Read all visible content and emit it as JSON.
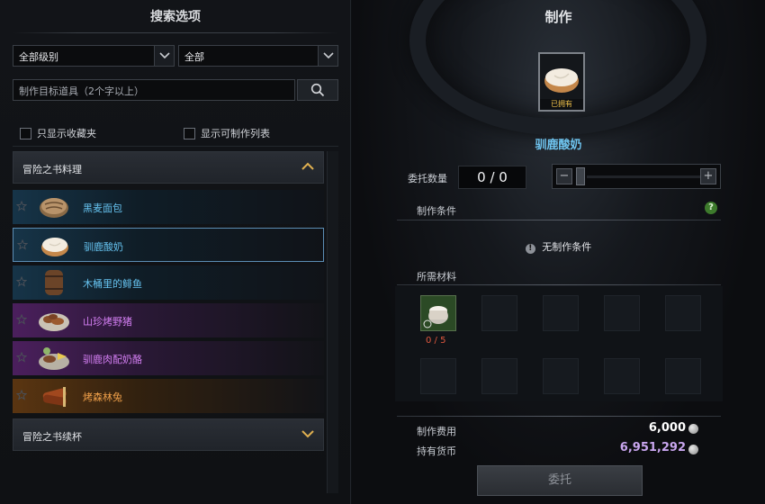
{
  "filters": {
    "title": "搜索选项",
    "grade_select": "全部级别",
    "type_select": "全部",
    "search_placeholder": "制作目标道具（2个字以上）",
    "favorites_only": "只显示收藏夹",
    "craftable_only": "显示可制作列表"
  },
  "categories": {
    "open_title": "冒险之书料理",
    "collapsed_title": "冒险之书续杯"
  },
  "recipes": [
    {
      "name": "黑麦面包",
      "rarity": "blue"
    },
    {
      "name": "驯鹿酸奶",
      "rarity": "blue",
      "selected": true
    },
    {
      "name": "木桶里的鲱鱼",
      "rarity": "blue"
    },
    {
      "name": "山珍烤野猪",
      "rarity": "purple"
    },
    {
      "name": "驯鹿肉配奶酪",
      "rarity": "purple"
    },
    {
      "name": "烤森林兔",
      "rarity": "orange"
    }
  ],
  "craft": {
    "title": "制作",
    "owned_tag": "已拥有",
    "product_name": "驯鹿酸奶",
    "qty_label": "委托数量",
    "qty_value": "0 / 0",
    "slider_minus": "−",
    "slider_plus": "+",
    "condition_label": "制作条件",
    "help": "?",
    "no_condition": "无制作条件",
    "materials_label": "所需材料",
    "material_count": "0 / 5",
    "cost_label": "制作费用",
    "cost_value": "6,000",
    "balance_label": "持有货币",
    "balance_value": "6,951,292",
    "commit_button": "委托"
  },
  "colors": {
    "rarity_blue": "#66c3f0",
    "rarity_purple": "#d47ff3",
    "rarity_orange": "#f0a04a",
    "missing_material": "#e0583f",
    "balance": "#c9a6ef"
  }
}
